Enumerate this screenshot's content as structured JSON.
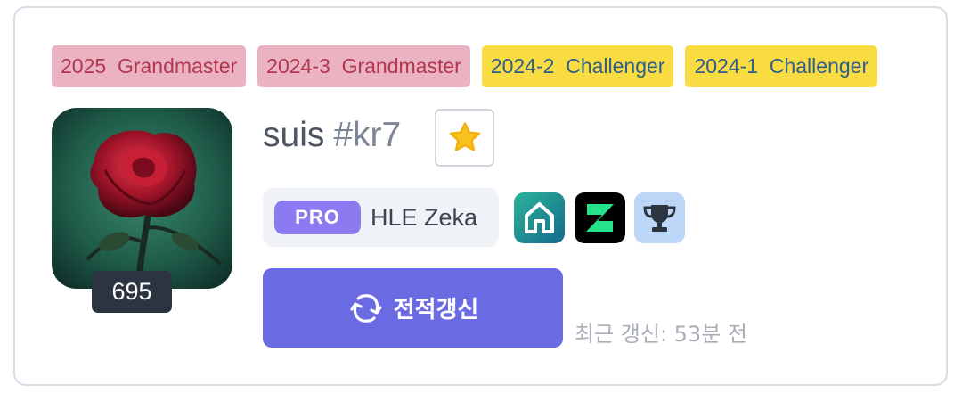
{
  "tiers": [
    {
      "season": "2025",
      "tier": "Grandmaster",
      "kind": "gm"
    },
    {
      "season": "2024-3",
      "tier": "Grandmaster",
      "kind": "gm"
    },
    {
      "season": "2024-2",
      "tier": "Challenger",
      "kind": "ch"
    },
    {
      "season": "2024-1",
      "tier": "Challenger",
      "kind": "ch"
    }
  ],
  "profile": {
    "game_name": "suis",
    "tag_line": "#kr7",
    "level": "695",
    "avatar_icon": "rose-profile-icon",
    "favorite_icon": "star-icon",
    "favorite_color": "#f7c21e"
  },
  "pro": {
    "badge": "PRO",
    "name": "HLE Zeka",
    "badge_color": "#8c7bf0"
  },
  "sites": [
    {
      "icon": "home-icon",
      "color": "#1f9d88"
    },
    {
      "icon": "z-logo-icon",
      "color": "#000000"
    },
    {
      "icon": "trophy-icon",
      "color": "#bcd6f7"
    }
  ],
  "refresh": {
    "label": "전적갱신",
    "icon": "refresh-icon",
    "color": "#6a6be3"
  },
  "last_updated": "최근 갱신: 53분 전"
}
